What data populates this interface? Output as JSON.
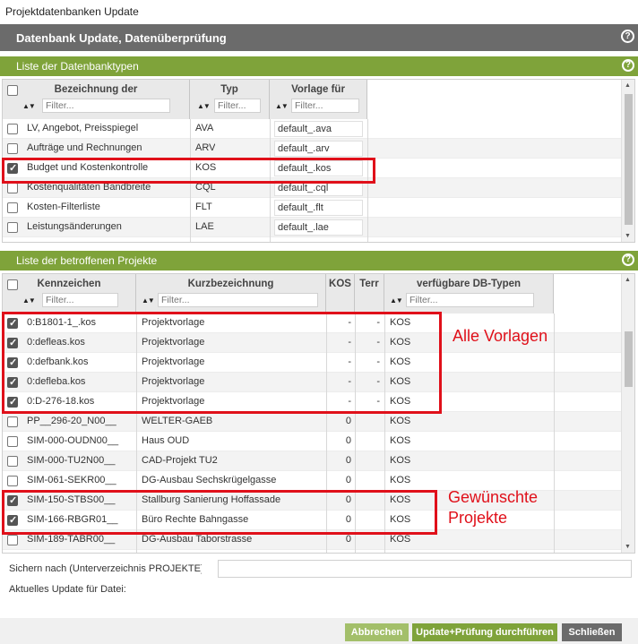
{
  "window_title": "Projektdatenbanken Update",
  "main_header": "Datenbank Update, Datenüberprüfung",
  "help_glyph": "?",
  "sort_glyph": "▲▼",
  "filter_placeholder": "Filter...",
  "section1": {
    "title": "Liste der Datenbanktypen",
    "columns": [
      "Bezeichnung der",
      "Typ",
      "Vorlage für"
    ],
    "rows": [
      {
        "name": "LV, Angebot, Preisspiegel",
        "type": "AVA",
        "template": "default_.ava",
        "checked": false
      },
      {
        "name": "Aufträge und Rechnungen",
        "type": "ARV",
        "template": "default_.arv",
        "checked": false
      },
      {
        "name": "Budget und Kostenkontrolle",
        "type": "KOS",
        "template": "default_.kos",
        "checked": true
      },
      {
        "name": "Kostenqualitäten Bandbreite",
        "type": "CQL",
        "template": "default_.cql",
        "checked": false
      },
      {
        "name": "Kosten-Filterliste",
        "type": "FLT",
        "template": "default_.flt",
        "checked": false
      },
      {
        "name": "Leistungsänderungen",
        "type": "LAE",
        "template": "default_.lae",
        "checked": false
      }
    ]
  },
  "section2": {
    "title": "Liste der betroffenen Projekte",
    "columns": [
      "Kennzeichen",
      "Kurzbezeichnung",
      "KOS",
      "Terr",
      "verfügbare DB-Typen"
    ],
    "rows": [
      {
        "id": "0:B1801-1_.kos",
        "name": "Projektvorlage",
        "kos": "-",
        "terr": "-",
        "types": "KOS",
        "checked": true
      },
      {
        "id": "0:defleas.kos",
        "name": "Projektvorlage",
        "kos": "-",
        "terr": "-",
        "types": "KOS",
        "checked": true
      },
      {
        "id": "0:defbank.kos",
        "name": "Projektvorlage",
        "kos": "-",
        "terr": "-",
        "types": "KOS",
        "checked": true
      },
      {
        "id": "0:defleba.kos",
        "name": "Projektvorlage",
        "kos": "-",
        "terr": "-",
        "types": "KOS",
        "checked": true
      },
      {
        "id": "0:D-276-18.kos",
        "name": "Projektvorlage",
        "kos": "-",
        "terr": "-",
        "types": "KOS",
        "checked": true
      },
      {
        "id": "PP__296-20_N00__",
        "name": "WELTER-GAEB",
        "kos": "0",
        "terr": "",
        "types": "KOS",
        "checked": false
      },
      {
        "id": "SIM-000-OUDN00__",
        "name": "Haus OUD",
        "kos": "0",
        "terr": "",
        "types": "KOS",
        "checked": false
      },
      {
        "id": "SIM-000-TU2N00__",
        "name": "CAD-Projekt TU2",
        "kos": "0",
        "terr": "",
        "types": "KOS",
        "checked": false
      },
      {
        "id": "SIM-061-SEKR00__",
        "name": "DG-Ausbau Sechskrügelgasse",
        "kos": "0",
        "terr": "",
        "types": "KOS",
        "checked": false
      },
      {
        "id": "SIM-150-STBS00__",
        "name": "Stallburg Sanierung Hoffassade",
        "kos": "0",
        "terr": "",
        "types": "KOS",
        "checked": true
      },
      {
        "id": "SIM-166-RBGR01__",
        "name": "Büro Rechte Bahngasse",
        "kos": "0",
        "terr": "",
        "types": "KOS",
        "checked": true
      },
      {
        "id": "SIM-189-TABR00__",
        "name": "DG-Ausbau Taborstrasse",
        "kos": "0",
        "terr": "",
        "types": "KOS",
        "checked": false
      }
    ]
  },
  "annotations": {
    "all_templates": "Alle Vorlagen",
    "desired_line1": "Gewünschte",
    "desired_line2": "Projekte"
  },
  "save_to_label": "Sichern nach (Unterverzeichnis PROJEKTE)",
  "current_update_label": "Aktuelles Update für Datei:",
  "buttons": {
    "cancel": "Abbrechen",
    "run": "Update+Prüfung durchführen",
    "close": "Schließen"
  },
  "colors": {
    "header_gray": "#6b6b6b",
    "section_green": "#7fa33a",
    "annotation_red": "#e0101a"
  }
}
